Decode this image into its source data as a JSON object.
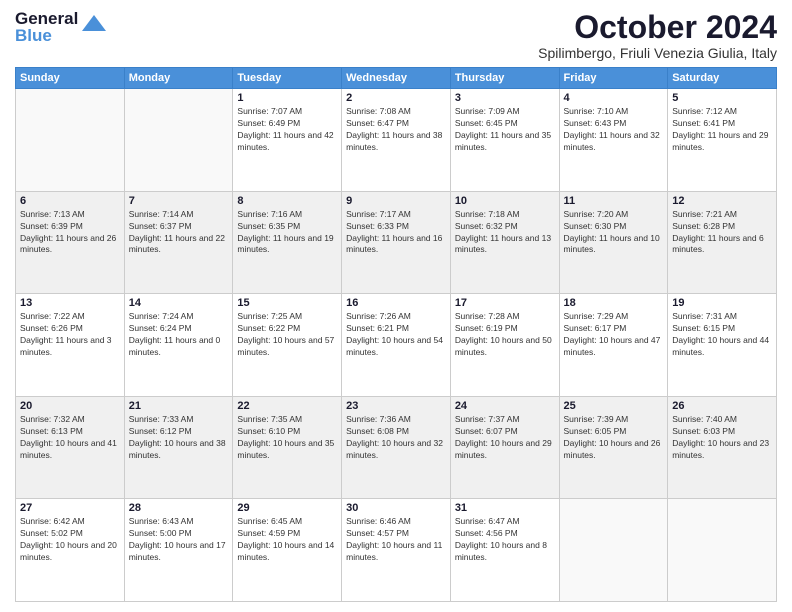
{
  "header": {
    "logo_general": "General",
    "logo_blue": "Blue",
    "month_title": "October 2024",
    "location": "Spilimbergo, Friuli Venezia Giulia, Italy"
  },
  "days_of_week": [
    "Sunday",
    "Monday",
    "Tuesday",
    "Wednesday",
    "Thursday",
    "Friday",
    "Saturday"
  ],
  "weeks": [
    [
      {
        "num": "",
        "info": ""
      },
      {
        "num": "",
        "info": ""
      },
      {
        "num": "1",
        "info": "Sunrise: 7:07 AM\nSunset: 6:49 PM\nDaylight: 11 hours and 42 minutes."
      },
      {
        "num": "2",
        "info": "Sunrise: 7:08 AM\nSunset: 6:47 PM\nDaylight: 11 hours and 38 minutes."
      },
      {
        "num": "3",
        "info": "Sunrise: 7:09 AM\nSunset: 6:45 PM\nDaylight: 11 hours and 35 minutes."
      },
      {
        "num": "4",
        "info": "Sunrise: 7:10 AM\nSunset: 6:43 PM\nDaylight: 11 hours and 32 minutes."
      },
      {
        "num": "5",
        "info": "Sunrise: 7:12 AM\nSunset: 6:41 PM\nDaylight: 11 hours and 29 minutes."
      }
    ],
    [
      {
        "num": "6",
        "info": "Sunrise: 7:13 AM\nSunset: 6:39 PM\nDaylight: 11 hours and 26 minutes."
      },
      {
        "num": "7",
        "info": "Sunrise: 7:14 AM\nSunset: 6:37 PM\nDaylight: 11 hours and 22 minutes."
      },
      {
        "num": "8",
        "info": "Sunrise: 7:16 AM\nSunset: 6:35 PM\nDaylight: 11 hours and 19 minutes."
      },
      {
        "num": "9",
        "info": "Sunrise: 7:17 AM\nSunset: 6:33 PM\nDaylight: 11 hours and 16 minutes."
      },
      {
        "num": "10",
        "info": "Sunrise: 7:18 AM\nSunset: 6:32 PM\nDaylight: 11 hours and 13 minutes."
      },
      {
        "num": "11",
        "info": "Sunrise: 7:20 AM\nSunset: 6:30 PM\nDaylight: 11 hours and 10 minutes."
      },
      {
        "num": "12",
        "info": "Sunrise: 7:21 AM\nSunset: 6:28 PM\nDaylight: 11 hours and 6 minutes."
      }
    ],
    [
      {
        "num": "13",
        "info": "Sunrise: 7:22 AM\nSunset: 6:26 PM\nDaylight: 11 hours and 3 minutes."
      },
      {
        "num": "14",
        "info": "Sunrise: 7:24 AM\nSunset: 6:24 PM\nDaylight: 11 hours and 0 minutes."
      },
      {
        "num": "15",
        "info": "Sunrise: 7:25 AM\nSunset: 6:22 PM\nDaylight: 10 hours and 57 minutes."
      },
      {
        "num": "16",
        "info": "Sunrise: 7:26 AM\nSunset: 6:21 PM\nDaylight: 10 hours and 54 minutes."
      },
      {
        "num": "17",
        "info": "Sunrise: 7:28 AM\nSunset: 6:19 PM\nDaylight: 10 hours and 50 minutes."
      },
      {
        "num": "18",
        "info": "Sunrise: 7:29 AM\nSunset: 6:17 PM\nDaylight: 10 hours and 47 minutes."
      },
      {
        "num": "19",
        "info": "Sunrise: 7:31 AM\nSunset: 6:15 PM\nDaylight: 10 hours and 44 minutes."
      }
    ],
    [
      {
        "num": "20",
        "info": "Sunrise: 7:32 AM\nSunset: 6:13 PM\nDaylight: 10 hours and 41 minutes."
      },
      {
        "num": "21",
        "info": "Sunrise: 7:33 AM\nSunset: 6:12 PM\nDaylight: 10 hours and 38 minutes."
      },
      {
        "num": "22",
        "info": "Sunrise: 7:35 AM\nSunset: 6:10 PM\nDaylight: 10 hours and 35 minutes."
      },
      {
        "num": "23",
        "info": "Sunrise: 7:36 AM\nSunset: 6:08 PM\nDaylight: 10 hours and 32 minutes."
      },
      {
        "num": "24",
        "info": "Sunrise: 7:37 AM\nSunset: 6:07 PM\nDaylight: 10 hours and 29 minutes."
      },
      {
        "num": "25",
        "info": "Sunrise: 7:39 AM\nSunset: 6:05 PM\nDaylight: 10 hours and 26 minutes."
      },
      {
        "num": "26",
        "info": "Sunrise: 7:40 AM\nSunset: 6:03 PM\nDaylight: 10 hours and 23 minutes."
      }
    ],
    [
      {
        "num": "27",
        "info": "Sunrise: 6:42 AM\nSunset: 5:02 PM\nDaylight: 10 hours and 20 minutes."
      },
      {
        "num": "28",
        "info": "Sunrise: 6:43 AM\nSunset: 5:00 PM\nDaylight: 10 hours and 17 minutes."
      },
      {
        "num": "29",
        "info": "Sunrise: 6:45 AM\nSunset: 4:59 PM\nDaylight: 10 hours and 14 minutes."
      },
      {
        "num": "30",
        "info": "Sunrise: 6:46 AM\nSunset: 4:57 PM\nDaylight: 10 hours and 11 minutes."
      },
      {
        "num": "31",
        "info": "Sunrise: 6:47 AM\nSunset: 4:56 PM\nDaylight: 10 hours and 8 minutes."
      },
      {
        "num": "",
        "info": ""
      },
      {
        "num": "",
        "info": ""
      }
    ]
  ]
}
